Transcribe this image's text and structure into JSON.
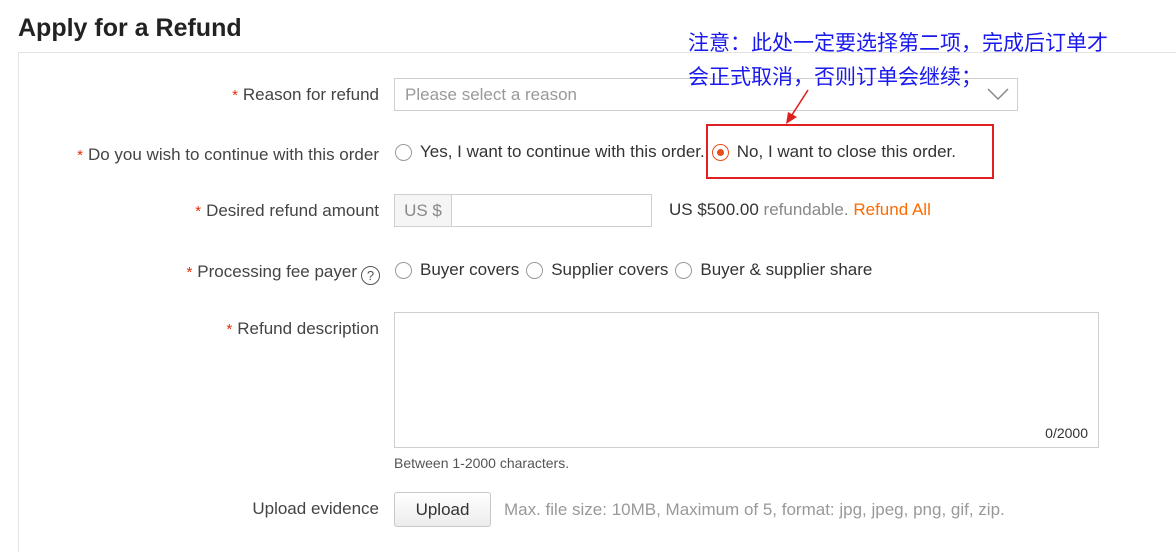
{
  "page": {
    "title": "Apply for a Refund"
  },
  "required_mark": "*",
  "reason": {
    "label": "Reason for refund",
    "placeholder": "Please select a reason"
  },
  "continue_order": {
    "label": "Do you wish to continue with this order",
    "options": [
      {
        "label": "Yes, I want to continue with this order.",
        "selected": false
      },
      {
        "label": "No, I want to close this order.",
        "selected": true
      }
    ]
  },
  "amount": {
    "label": "Desired refund amount",
    "currency": "US $",
    "value": "",
    "refundable_amount": "US $500.00",
    "refundable_text": "refundable.",
    "refund_all": "Refund All"
  },
  "fee_payer": {
    "label": "Processing fee payer",
    "help_icon": "?",
    "options": [
      {
        "label": "Buyer covers",
        "selected": false
      },
      {
        "label": "Supplier covers",
        "selected": false
      },
      {
        "label": "Buyer & supplier share",
        "selected": false
      }
    ]
  },
  "description": {
    "label": "Refund description",
    "value": "",
    "counter": "0/2000",
    "hint": "Between 1-2000 characters."
  },
  "upload": {
    "label": "Upload evidence",
    "button": "Upload",
    "hint": "Max. file size: 10MB, Maximum of 5, format: jpg, jpeg, png, gif, zip."
  },
  "annotation": {
    "line1": "注意：此处一定要选择第二项，完成后订单才",
    "line2": "会正式取消，否则订单会继续；",
    "color": "#1a1aee",
    "box_color": "#e02020"
  }
}
